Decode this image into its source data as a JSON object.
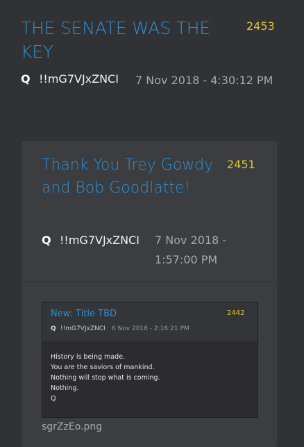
{
  "post": {
    "title": "THE SENATE WAS THE KEY",
    "number": "2453",
    "author": "Q",
    "tripcode": "!!mG7VJxZNCI",
    "date": "7 Nov 2018 - 4:30:12 PM"
  },
  "quoted_post": {
    "title": "Thank You Trey Gowdy and Bob Goodlatte!",
    "number": "2451",
    "author": "Q",
    "tripcode": "!!mG7VJxZNCI",
    "date": "7 Nov 2018 - 1:57:00 PM",
    "embedded": {
      "title": "New: Title TBD",
      "number": "2442",
      "author": "Q",
      "tripcode": "!!mG7VJxZNCI",
      "date": "6 Nov 2018 - 2:16:21 PM",
      "lines": [
        "History is being made.",
        "You are the saviors of mankind.",
        "Nothing will stop what is coming.",
        "Nothing.",
        "Q"
      ]
    },
    "attachment_filename": "sgrZzEo.png"
  }
}
